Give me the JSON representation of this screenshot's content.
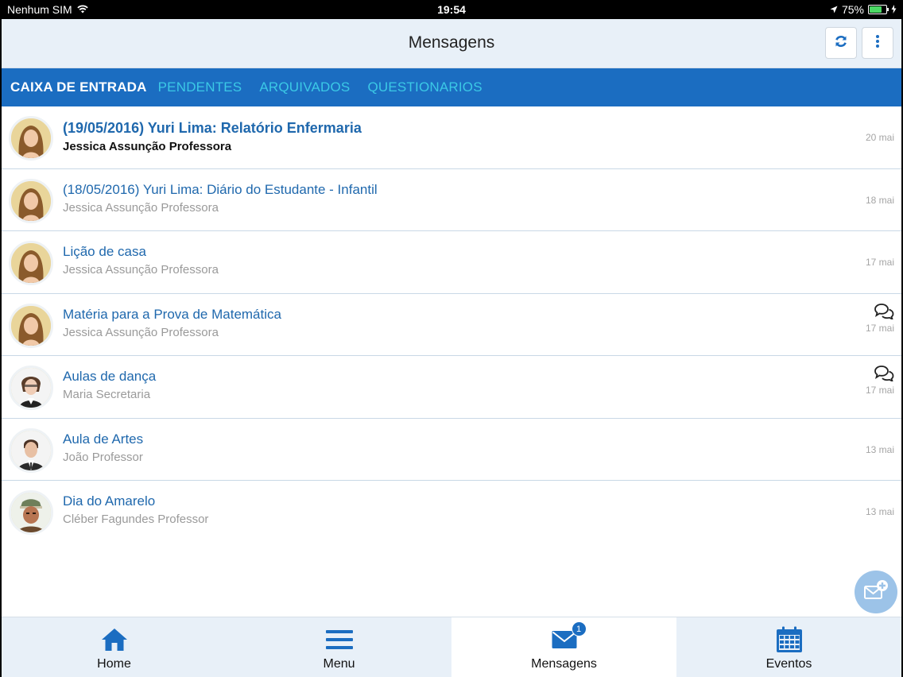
{
  "status_bar": {
    "carrier": "Nenhum SIM",
    "time": "19:54",
    "battery": "75%",
    "battery_level": 0.75
  },
  "header": {
    "title": "Mensagens",
    "refresh_icon": "refresh-icon",
    "more_icon": "more-vertical-icon"
  },
  "tabs": [
    {
      "label": "CAIXA DE ENTRADA",
      "active": true
    },
    {
      "label": "PENDENTES",
      "active": false
    },
    {
      "label": "ARQUIVADOS",
      "active": false
    },
    {
      "label": "QUESTIONARIOS",
      "active": false
    }
  ],
  "messages": [
    {
      "subject": "(19/05/2016) Yuri Lima: Relatório Enfermaria",
      "sender": "Jessica Assunção Professora",
      "date": "20 mai",
      "unread": true,
      "has_replies": false
    },
    {
      "subject": "(18/05/2016) Yuri Lima: Diário do Estudante - Infantil",
      "sender": "Jessica Assunção Professora",
      "date": "18 mai",
      "unread": false,
      "has_replies": false
    },
    {
      "subject": "Lição de casa",
      "sender": "Jessica Assunção Professora",
      "date": "17 mai",
      "unread": false,
      "has_replies": false
    },
    {
      "subject": "Matéria para a Prova de Matemática",
      "sender": "Jessica Assunção Professora",
      "date": "17 mai",
      "unread": false,
      "has_replies": true
    },
    {
      "subject": "Aulas de dança",
      "sender": "Maria Secretaria",
      "date": "17 mai",
      "unread": false,
      "has_replies": true
    },
    {
      "subject": "Aula de Artes",
      "sender": "João Professor",
      "date": "13 mai",
      "unread": false,
      "has_replies": false
    },
    {
      "subject": "Dia do Amarelo",
      "sender": "Cléber Fagundes Professor",
      "date": "13 mai",
      "unread": false,
      "has_replies": false
    }
  ],
  "fab": {
    "icon": "compose-message-icon"
  },
  "bottom_nav": [
    {
      "label": "Home",
      "icon": "home-icon",
      "active": false
    },
    {
      "label": "Menu",
      "icon": "menu-icon",
      "active": false
    },
    {
      "label": "Mensagens",
      "icon": "envelope-icon",
      "active": true,
      "badge": "1"
    },
    {
      "label": "Eventos",
      "icon": "calendar-icon",
      "active": false
    }
  ],
  "colors": {
    "accent": "#1b6dc1",
    "tab_inactive": "#3bc9e6",
    "link": "#1f68ad",
    "header_bg": "#e8f0f8"
  }
}
